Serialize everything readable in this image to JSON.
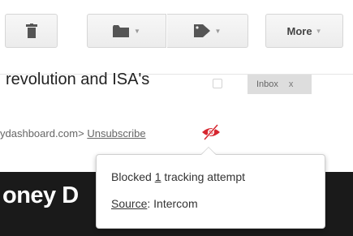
{
  "toolbar": {
    "trash_icon": "trash-icon",
    "folder_icon": "folder-icon",
    "label_icon": "tag-icon",
    "more_label": "More"
  },
  "email": {
    "subject": "revolution and ISA's",
    "label_chip": "Inbox",
    "label_remove": "x",
    "sender_partial": "ydashboard.com>",
    "unsubscribe": "Unsubscribe",
    "tracker_icon": "blocked-eye-icon"
  },
  "banner": {
    "text": "oney D"
  },
  "popup": {
    "blocked_prefix": "Blocked",
    "blocked_count": "1",
    "blocked_suffix": "tracking attempt",
    "source_label": "Source",
    "source_value": ": Intercom"
  },
  "colors": {
    "tracker_red": "#d6262f",
    "banner_bg": "#1a1a1a"
  }
}
